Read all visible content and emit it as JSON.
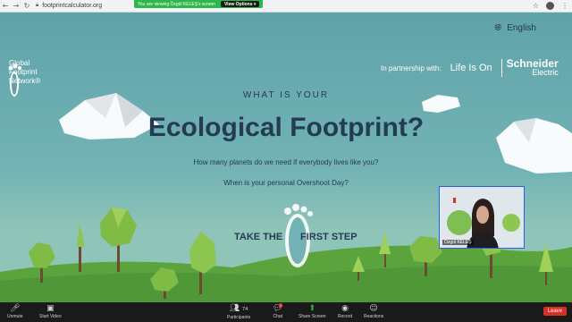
{
  "browser": {
    "url": "footprintcalculator.org",
    "share_banner": "You are viewing Özgül KELEŞ's screen",
    "view_options": "View Options"
  },
  "site": {
    "org_name_lines": [
      "Global",
      "Footprint",
      "Network®"
    ],
    "language": "English",
    "partnership_label": "In partnership with:",
    "partner1": "Life Is On",
    "partner2_line1": "Schneider",
    "partner2_line2": "Electric",
    "kicker": "WHAT IS YOUR",
    "title": "Ecological Footprint?",
    "question1": "How many planets do we need if everybody lives like you?",
    "question2": "When is your personal Overshoot Day?",
    "cta_left": "TAKE THE",
    "cta_right": "FIRST STEP"
  },
  "webcam": {
    "name": "Özgül KELEŞ"
  },
  "zoom": {
    "unmute": "Unmute",
    "start_video": "Start Video",
    "participants": "Participants",
    "participants_count": "74",
    "chat": "Chat",
    "chat_badge": "1",
    "share_screen": "Share Screen",
    "record": "Record",
    "reactions": "Reactions",
    "leave": "Leave"
  },
  "icons": {
    "back": "back-arrow-icon",
    "forward": "forward-arrow-icon",
    "reload": "reload-icon",
    "lock": "lock-icon",
    "globe": "globe-icon",
    "chevron": "chevron-down-icon",
    "footprint": "footprint-icon"
  },
  "colors": {
    "sky": "#5fa3a9",
    "grass": "#5aa33d",
    "title": "#233c52",
    "share_green": "#2db74a",
    "leave_red": "#d93025"
  }
}
